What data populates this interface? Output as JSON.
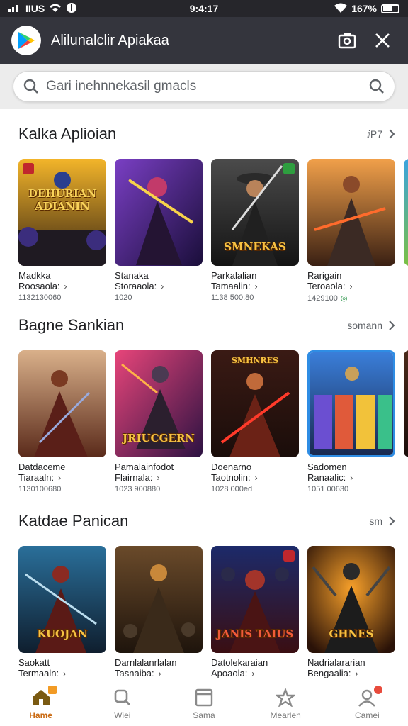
{
  "status_bar": {
    "carrier": "IIUS",
    "time": "9:4:17",
    "battery": "167%"
  },
  "app_bar": {
    "title": "Alilunalclir Apiakaa"
  },
  "search": {
    "placeholder": "Gari inehnnekasil gmacls"
  },
  "sections": [
    {
      "title": "Kalka Aplioian",
      "see_more": "ⅈP7",
      "cards": [
        {
          "name": "Madkka",
          "subtitle": "Roosaola:",
          "meta": "1132130060",
          "art_text": "DEHURIAN ADIANIN"
        },
        {
          "name": "Stanaka",
          "subtitle": "Storaaola:",
          "meta": "1020",
          "art_text": ""
        },
        {
          "name": "Parkalalian",
          "subtitle": "Tamaalin:",
          "meta": "1138 500:80",
          "art_text": "SMNEKAS"
        },
        {
          "name": "Rarigain",
          "subtitle": "Teroaola:",
          "meta": "1429100",
          "art_text": ""
        }
      ]
    },
    {
      "title": "Bagne Sankian",
      "see_more": "somann",
      "cards": [
        {
          "name": "Datdaceme",
          "subtitle": "Tiaraaln:",
          "meta": "1130100680",
          "art_text": ""
        },
        {
          "name": "Pamalainfodot",
          "subtitle": "Flairnala:",
          "meta": "1023 900880",
          "art_text": "JRIUCGERN"
        },
        {
          "name": "Doenarno",
          "subtitle": "Taotnolin:",
          "meta": "1028 000ed",
          "art_text": "SMHNRES"
        },
        {
          "name": "Sadomen",
          "subtitle": "Ranaalic:",
          "meta": "1051 00630",
          "art_text": ""
        }
      ]
    },
    {
      "title": "Katdae Panican",
      "see_more": "sm",
      "cards": [
        {
          "name": "Saokatt",
          "subtitle": "Termaaln:",
          "meta": "",
          "art_text": "KUOJAN"
        },
        {
          "name": "Darnlalanrlalan",
          "subtitle": "Tasnaiba:",
          "meta": "",
          "art_text": ""
        },
        {
          "name": "Datolekaraian",
          "subtitle": "Apoaola:",
          "meta": "",
          "art_text": "JANIS TAIUS"
        },
        {
          "name": "Nadrialararian",
          "subtitle": "Bengaalia:",
          "meta": "",
          "art_text": "GHNES"
        }
      ]
    }
  ],
  "bottom_nav": [
    {
      "label": "Hame",
      "icon": "home-icon",
      "active": true
    },
    {
      "label": "Wiei",
      "icon": "search-icon",
      "active": false
    },
    {
      "label": "Sama",
      "icon": "tablet-icon",
      "active": false
    },
    {
      "label": "Mearlen",
      "icon": "star-icon",
      "active": false
    },
    {
      "label": "Camei",
      "icon": "profile-icon",
      "active": false
    }
  ],
  "colors": {
    "app_bar": "#34353d",
    "status_bar": "#26262b",
    "accent": "#c96a12",
    "green": "#1e8e3e"
  }
}
